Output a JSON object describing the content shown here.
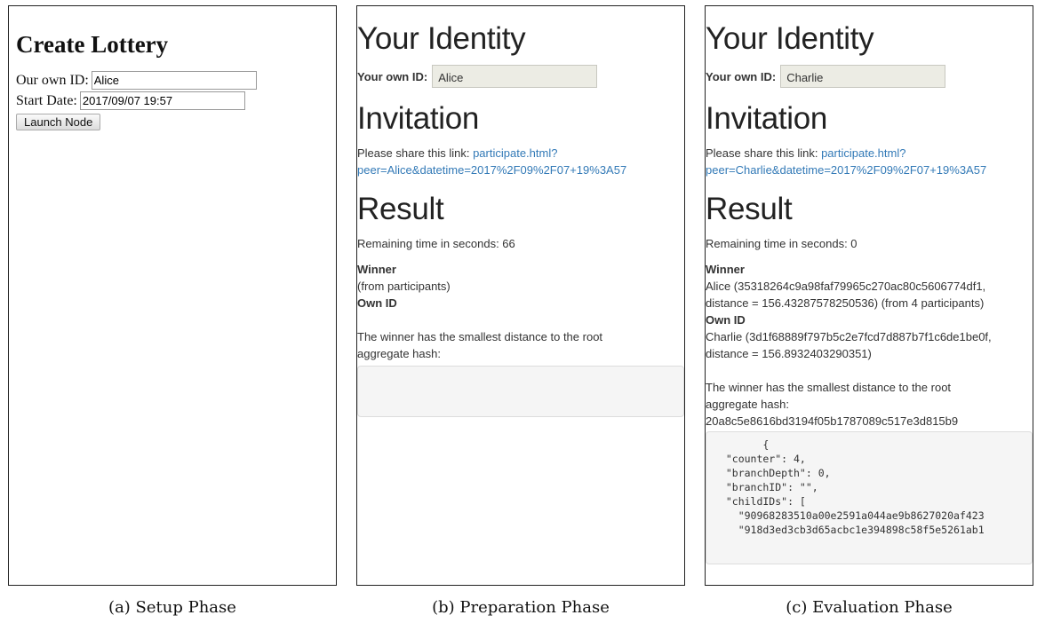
{
  "panel_setup": {
    "title": "Create Lottery",
    "own_id_label": "Our own ID:",
    "own_id_value": "Alice",
    "start_date_label": "Start Date:",
    "start_date_value": "2017/09/07 19:57",
    "launch_button": "Launch Node",
    "caption": "(a) Setup Phase"
  },
  "panel_prep": {
    "identity_heading": "Your Identity",
    "own_id_label": "Your own ID:",
    "own_id_value": "Alice",
    "invitation_heading": "Invitation",
    "share_text": "Please share this link:",
    "link_line1": "participate.html?",
    "link_line2": "peer=Alice&datetime=2017%2F09%2F07+19%3A57",
    "result_heading": "Result",
    "remaining_text": "Remaining time in seconds: 66",
    "winner_label": "Winner",
    "winner_value": "(from participants)",
    "own_id_section_label": "Own ID",
    "explanation_line1": "The winner has the smallest distance to the root",
    "explanation_line2": "aggregate hash:",
    "code_block": "",
    "caption": "(b) Preparation Phase"
  },
  "panel_eval": {
    "identity_heading": "Your Identity",
    "own_id_label": "Your own ID:",
    "own_id_value": "Charlie",
    "invitation_heading": "Invitation",
    "share_text": "Please share this link:",
    "link_line1": "participate.html?",
    "link_line2": "peer=Charlie&datetime=2017%2F09%2F07+19%3A57",
    "result_heading": "Result",
    "remaining_text": "Remaining time in seconds: 0",
    "winner_label": "Winner",
    "winner_line1": "Alice (35318264c9a98faf79965c270ac80c5606774df1,",
    "winner_line2": "distance = 156.43287578250536) (from 4 participants)",
    "own_id_section_label": "Own ID",
    "own_line1": "Charlie (3d1f68889f797b5c2e7fcd7d887b7f1c6de1be0f,",
    "own_line2": "distance = 156.8932403290351)",
    "explanation_line1": "The winner has the smallest distance to the root",
    "explanation_line2": "aggregate hash:",
    "root_hash": "20a8c5e8616bd3194f05b1787089c517e3d815b9",
    "code_block": "        {\n  \"counter\": 4,\n  \"branchDepth\": 0,\n  \"branchID\": \"\",\n  \"childIDs\": [\n    \"90968283510a00e2591a044ae9b8627020af423\n    \"918d3ed3cb3d65acbc1e394898c58f5e5261ab1",
    "caption": "(c) Evaluation Phase"
  }
}
